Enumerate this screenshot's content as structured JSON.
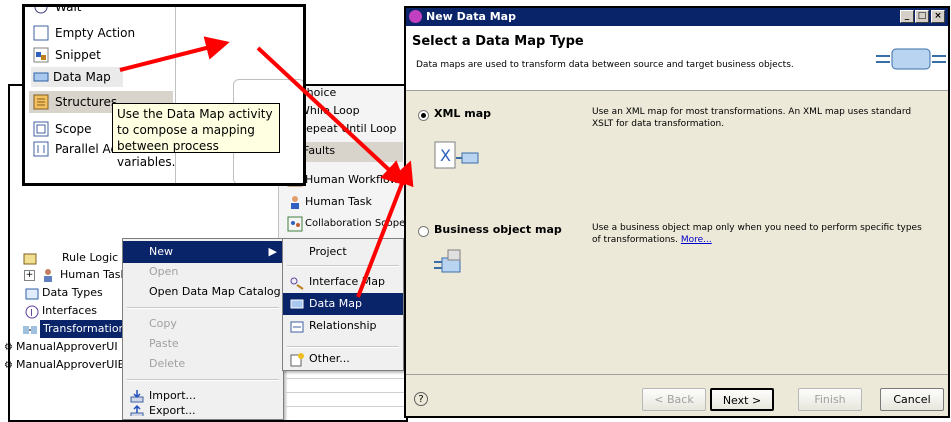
{
  "palette": {
    "items": [
      {
        "label": "Wait",
        "icon": "wait-icon"
      },
      {
        "label": "Empty Action",
        "icon": "empty-action-icon"
      },
      {
        "label": "Snippet",
        "icon": "snippet-icon"
      },
      {
        "label": "Data Map",
        "icon": "data-map-icon"
      },
      {
        "label": "Structures",
        "icon": "structures-icon"
      },
      {
        "label": "Scope",
        "icon": "scope-icon"
      },
      {
        "label": "Parallel Activ",
        "icon": "parallel-activities-icon"
      }
    ],
    "tooltip": "Use the Data Map activity to compose a mapping between process variables."
  },
  "background_palette": {
    "items": [
      "Choice",
      "While Loop",
      "Repeat Until Loop",
      "Faults",
      "Human Workflow",
      "Human Task",
      "Collaboration Scope"
    ]
  },
  "tree": {
    "items": [
      {
        "label": "Rule Logic"
      },
      {
        "label": "Human Tasks"
      },
      {
        "label": "Data Types"
      },
      {
        "label": "Interfaces"
      },
      {
        "label": "Transformations"
      },
      {
        "label": "ManualApproverUI"
      },
      {
        "label": "ManualApproverUIE"
      }
    ]
  },
  "context_menu": {
    "items": [
      {
        "label": "New",
        "disabled": false,
        "selected": true
      },
      {
        "label": "Open",
        "disabled": true
      },
      {
        "label": "Open Data Map Catalog",
        "disabled": false
      },
      {
        "label": "Copy",
        "disabled": true
      },
      {
        "label": "Paste",
        "disabled": true
      },
      {
        "label": "Delete",
        "disabled": true
      },
      {
        "label": "Import...",
        "disabled": false
      },
      {
        "label": "Export...",
        "disabled": false
      }
    ]
  },
  "submenu": {
    "items": [
      {
        "label": "Project"
      },
      {
        "label": "Interface Map"
      },
      {
        "label": "Data Map",
        "selected": true
      },
      {
        "label": "Relationship"
      },
      {
        "label": "Other..."
      }
    ]
  },
  "dialog": {
    "title": "New Data Map",
    "heading": "Select a Data Map Type",
    "description": "Data maps are used to transform data between source and target business objects.",
    "options": [
      {
        "label": "XML map",
        "selected": true,
        "description": "Use an XML map for most transformations. An XML map uses standard XSLT for data transformation.",
        "link": ""
      },
      {
        "label": "Business object map",
        "selected": false,
        "description": "Use a business object map only when you need to perform specific types of transformations.",
        "link": "More..."
      }
    ],
    "buttons": {
      "back": "< Back",
      "next": "Next >",
      "finish": "Finish",
      "cancel": "Cancel"
    },
    "help": "?"
  },
  "colors": {
    "arrow": "#ff0000",
    "selection": "#0a246a",
    "tooltip_bg": "#ffffe1",
    "dialog_bg": "#ece9d8"
  }
}
